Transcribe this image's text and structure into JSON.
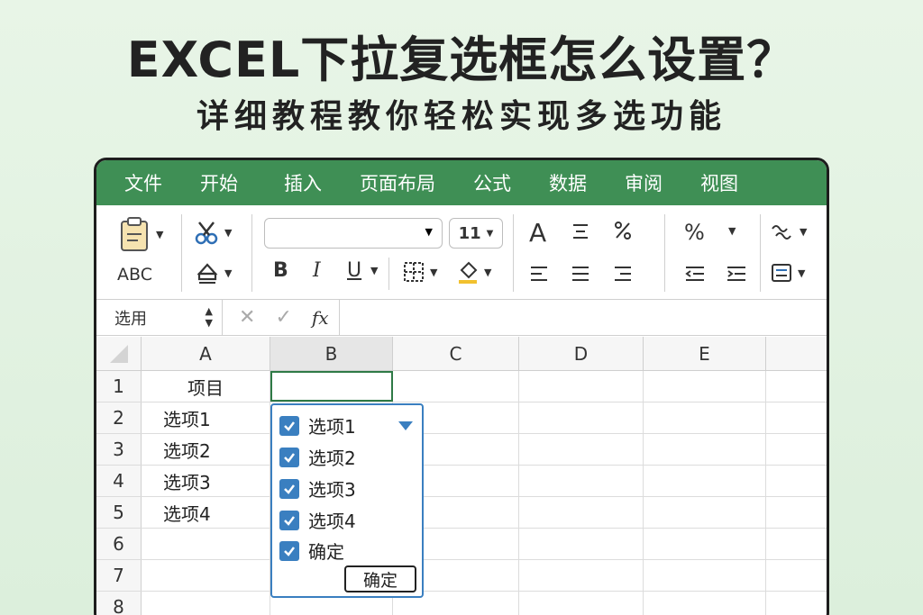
{
  "title": "EXCEL下拉复选框怎么设置？",
  "subtitle": "详细教程教你轻松实现多选功能",
  "menu": [
    "文件",
    "开始",
    "插入",
    "页面布局",
    "公式",
    "数据",
    "审阅",
    "视图"
  ],
  "ribbon": {
    "abc_label": "ABC",
    "font_size": "11",
    "big_a": "A",
    "percent": "%",
    "bold": "B",
    "italic": "I",
    "underline": "U"
  },
  "formula_bar": {
    "name_box": "选用",
    "fx": "fx"
  },
  "columns": [
    "A",
    "B",
    "C",
    "D",
    "E"
  ],
  "rows": [
    {
      "num": "1",
      "a": "项目"
    },
    {
      "num": "2",
      "a": "选项1"
    },
    {
      "num": "3",
      "a": "选项2"
    },
    {
      "num": "4",
      "a": "选项3"
    },
    {
      "num": "5",
      "a": "选项4"
    },
    {
      "num": "6",
      "a": ""
    },
    {
      "num": "7",
      "a": ""
    },
    {
      "num": "8",
      "a": ""
    }
  ],
  "dropdown": {
    "options": [
      {
        "label": "选项1",
        "checked": true
      },
      {
        "label": "选项2",
        "checked": true
      },
      {
        "label": "选项3",
        "checked": true
      },
      {
        "label": "选项4",
        "checked": true
      },
      {
        "label": "确定",
        "checked": true
      }
    ],
    "confirm_label": "确定"
  },
  "colors": {
    "menubar": "#3f8f55",
    "checkbox": "#3a7fc0",
    "background": "#e4f3e3"
  }
}
